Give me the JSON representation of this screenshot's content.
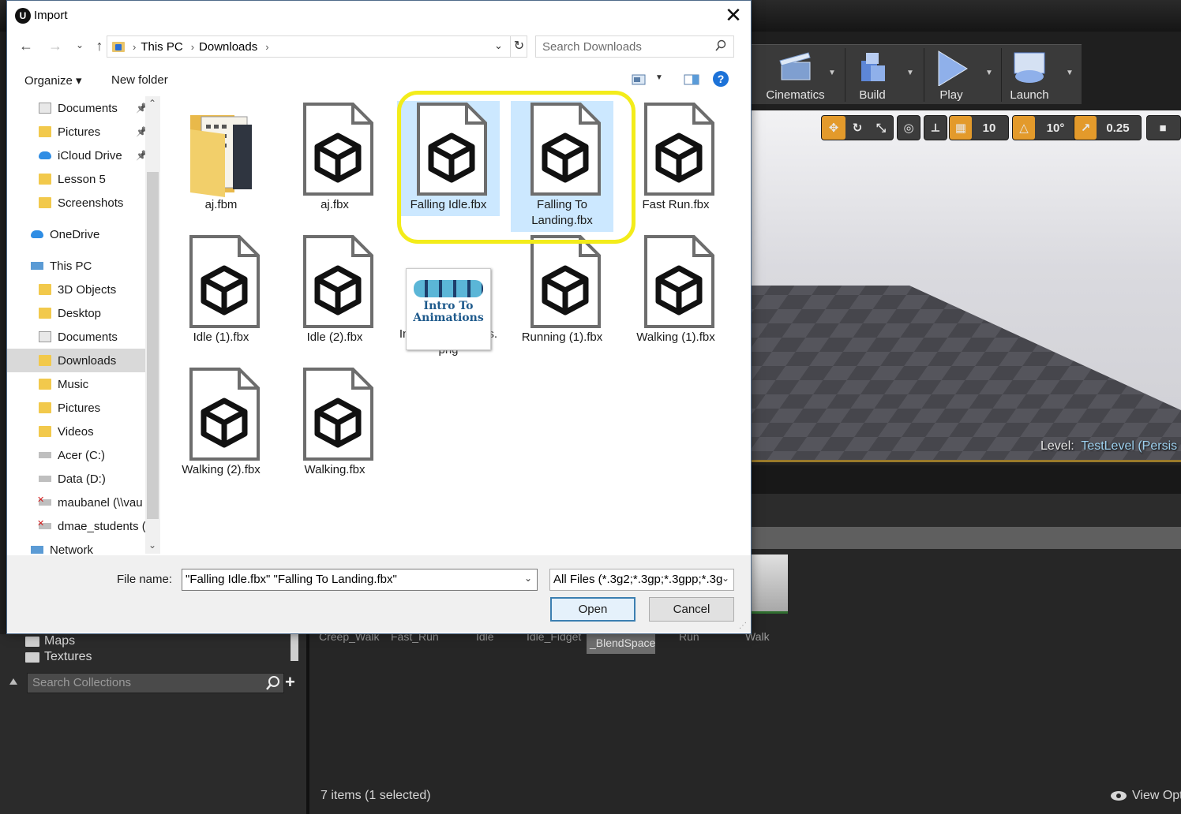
{
  "dialog": {
    "title": "Import",
    "close": "✕",
    "breadcrumb": [
      "This PC",
      "Downloads"
    ],
    "search_placeholder": "Search Downloads",
    "organize": "Organize ▾",
    "new_folder": "New folder",
    "help": "?",
    "nav_items": [
      {
        "label": "Documents",
        "icon": "doc",
        "pinned": true
      },
      {
        "label": "Pictures",
        "icon": "folder",
        "pinned": true
      },
      {
        "label": "iCloud Drive",
        "icon": "cloud",
        "pinned": true
      },
      {
        "label": "Lesson 5",
        "icon": "folder",
        "pinned": false
      },
      {
        "label": "Screenshots",
        "icon": "folder",
        "pinned": false
      },
      {
        "label": "OneDrive",
        "icon": "cloud",
        "pinned": false
      },
      {
        "label": "This PC",
        "icon": "pc",
        "pinned": false
      },
      {
        "label": "3D Objects",
        "icon": "folder",
        "pinned": false
      },
      {
        "label": "Desktop",
        "icon": "folder",
        "pinned": false
      },
      {
        "label": "Documents",
        "icon": "doc",
        "pinned": false
      },
      {
        "label": "Downloads",
        "icon": "folder",
        "pinned": false,
        "selected": true
      },
      {
        "label": "Music",
        "icon": "folder",
        "pinned": false
      },
      {
        "label": "Pictures",
        "icon": "folder",
        "pinned": false
      },
      {
        "label": "Videos",
        "icon": "folder",
        "pinned": false
      },
      {
        "label": "Acer (C:)",
        "icon": "drive",
        "pinned": false
      },
      {
        "label": "Data (D:)",
        "icon": "drive",
        "pinned": false
      },
      {
        "label": "maubanel (\\\\vau",
        "icon": "netdrive",
        "pinned": false
      },
      {
        "label": "dmae_students (",
        "icon": "netdrive",
        "pinned": false
      },
      {
        "label": "Network",
        "icon": "pc",
        "pinned": false
      }
    ],
    "files": [
      {
        "name": "aj.fbm",
        "kind": "folder",
        "selected": false
      },
      {
        "name": "aj.fbx",
        "kind": "fbx",
        "selected": false
      },
      {
        "name": "Falling Idle.fbx",
        "kind": "fbx",
        "selected": true
      },
      {
        "name": "Falling To Landing.fbx",
        "kind": "fbx",
        "selected": true
      },
      {
        "name": "Fast Run.fbx",
        "kind": "fbx",
        "selected": false
      },
      {
        "name": "Idle (1).fbx",
        "kind": "fbx",
        "selected": false
      },
      {
        "name": "Idle (2).fbx",
        "kind": "fbx",
        "selected": false
      },
      {
        "name": "IntroToAnimations.png",
        "kind": "png",
        "selected": false,
        "thumb_text": "Intro To Animations"
      },
      {
        "name": "Running (1).fbx",
        "kind": "fbx",
        "selected": false
      },
      {
        "name": "Walking (1).fbx",
        "kind": "fbx",
        "selected": false
      },
      {
        "name": "Walking (2).fbx",
        "kind": "fbx",
        "selected": false
      },
      {
        "name": "Walking.fbx",
        "kind": "fbx",
        "selected": false
      }
    ],
    "file_name_label": "File name:",
    "file_name_value": "\"Falling Idle.fbx\" \"Falling To Landing.fbx\"",
    "file_type_value": "All Files (*.3g2;*.3gp;*.3gpp;*.3g",
    "open_label": "Open",
    "cancel_label": "Cancel",
    "highlight_color": "#f3ec1a"
  },
  "unreal": {
    "toolbar": [
      "Cinematics",
      "Build",
      "Play",
      "Launch"
    ],
    "viewport_values": {
      "grid": "10",
      "rotation": "10°",
      "scale": "0.25"
    },
    "level_label": "Level:",
    "level_value": "TestLevel (Persis",
    "folders": [
      "Maps",
      "Textures"
    ],
    "collections_search": "Search Collections",
    "assets": [
      "Creep_Walk",
      "Fast_Run",
      "Idle",
      "Idle_Fidget",
      "_BlendSpace",
      "Run",
      "Walk"
    ],
    "status": "7 items (1 selected)",
    "view_options": "View Opti"
  }
}
